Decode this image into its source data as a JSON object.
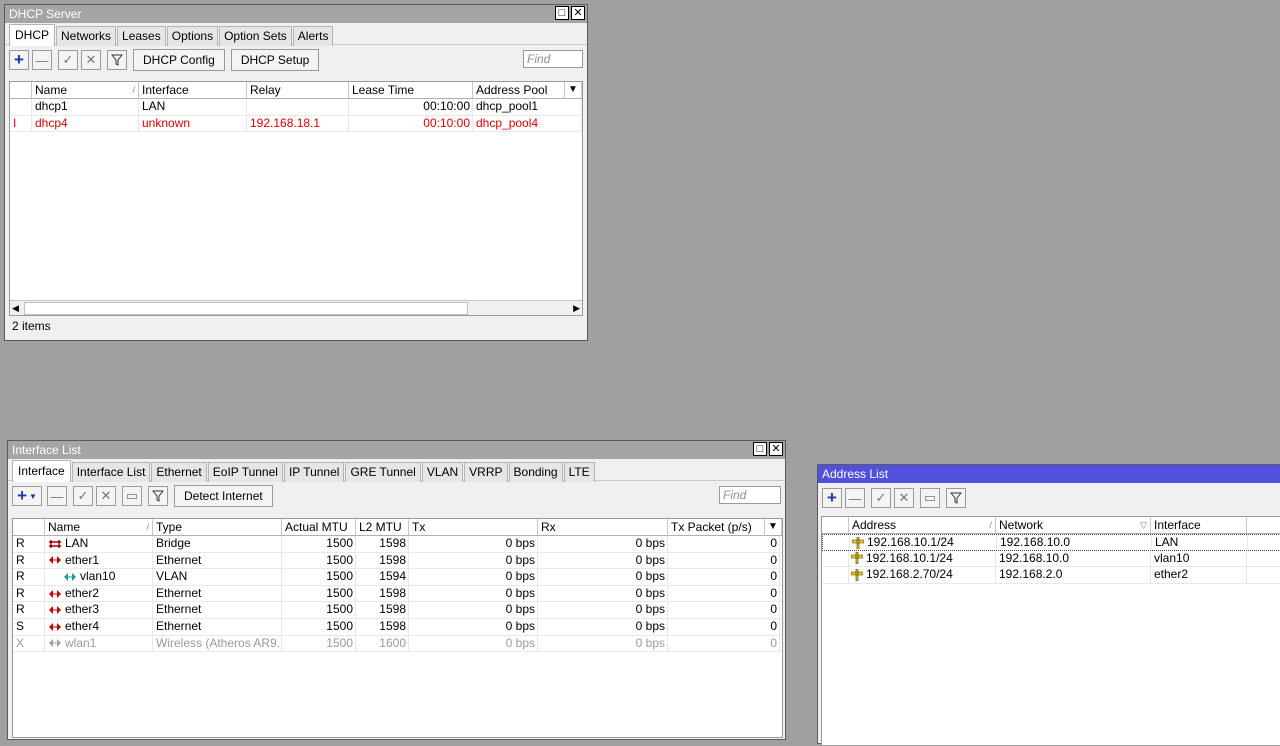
{
  "dhcp": {
    "title": "DHCP Server",
    "tabs": [
      "DHCP",
      "Networks",
      "Leases",
      "Options",
      "Option Sets",
      "Alerts"
    ],
    "buttons": {
      "config": "DHCP Config",
      "setup": "DHCP Setup"
    },
    "find_placeholder": "Find",
    "columns": [
      "Name",
      "Interface",
      "Relay",
      "Lease Time",
      "Address Pool"
    ],
    "rows": [
      {
        "flag": "",
        "name": "dhcp1",
        "interface": "LAN",
        "relay": "",
        "lease": "00:10:00",
        "pool": "dhcp_pool1"
      },
      {
        "flag": "I",
        "name": "dhcp4",
        "interface": "unknown",
        "relay": "192.168.18.1",
        "lease": "00:10:00",
        "pool": "dhcp_pool4"
      }
    ],
    "status": "2 items"
  },
  "iface": {
    "title": "Interface List",
    "tabs": [
      "Interface",
      "Interface List",
      "Ethernet",
      "EoIP Tunnel",
      "IP Tunnel",
      "GRE Tunnel",
      "VLAN",
      "VRRP",
      "Bonding",
      "LTE"
    ],
    "buttons": {
      "detect": "Detect Internet"
    },
    "find_placeholder": "Find",
    "columns": [
      "Name",
      "Type",
      "Actual MTU",
      "L2 MTU",
      "Tx",
      "Rx",
      "Tx Packet (p/s)"
    ],
    "rows": [
      {
        "flag": "R",
        "name": "LAN",
        "type": "Bridge",
        "mtu": "1500",
        "l2mtu": "1598",
        "tx": "0 bps",
        "rx": "0 bps",
        "txp": "0"
      },
      {
        "flag": "R",
        "name": "ether1",
        "type": "Ethernet",
        "mtu": "1500",
        "l2mtu": "1598",
        "tx": "0 bps",
        "rx": "0 bps",
        "txp": "0"
      },
      {
        "flag": "R",
        "name": "vlan10",
        "type": "VLAN",
        "mtu": "1500",
        "l2mtu": "1594",
        "tx": "0 bps",
        "rx": "0 bps",
        "txp": "0"
      },
      {
        "flag": "R",
        "name": "ether2",
        "type": "Ethernet",
        "mtu": "1500",
        "l2mtu": "1598",
        "tx": "0 bps",
        "rx": "0 bps",
        "txp": "0"
      },
      {
        "flag": "R",
        "name": "ether3",
        "type": "Ethernet",
        "mtu": "1500",
        "l2mtu": "1598",
        "tx": "0 bps",
        "rx": "0 bps",
        "txp": "0"
      },
      {
        "flag": "S",
        "name": "ether4",
        "type": "Ethernet",
        "mtu": "1500",
        "l2mtu": "1598",
        "tx": "0 bps",
        "rx": "0 bps",
        "txp": "0"
      },
      {
        "flag": "X",
        "name": "wlan1",
        "type": "Wireless (Atheros AR9...",
        "mtu": "1500",
        "l2mtu": "1600",
        "tx": "0 bps",
        "rx": "0 bps",
        "txp": "0"
      }
    ]
  },
  "addr": {
    "title": "Address List",
    "columns": [
      "Address",
      "Network",
      "Interface"
    ],
    "rows": [
      {
        "address": "192.168.10.1/24",
        "network": "192.168.10.0",
        "interface": "LAN"
      },
      {
        "address": "192.168.10.1/24",
        "network": "192.168.10.0",
        "interface": "vlan10"
      },
      {
        "address": "192.168.2.70/24",
        "network": "192.168.2.0",
        "interface": "ether2"
      }
    ]
  },
  "colors": {
    "active_title": "#5050dc",
    "inactive_title": "#a5a5a5",
    "invalid_row": "#e00000",
    "desktop": "#a0a0a0"
  }
}
